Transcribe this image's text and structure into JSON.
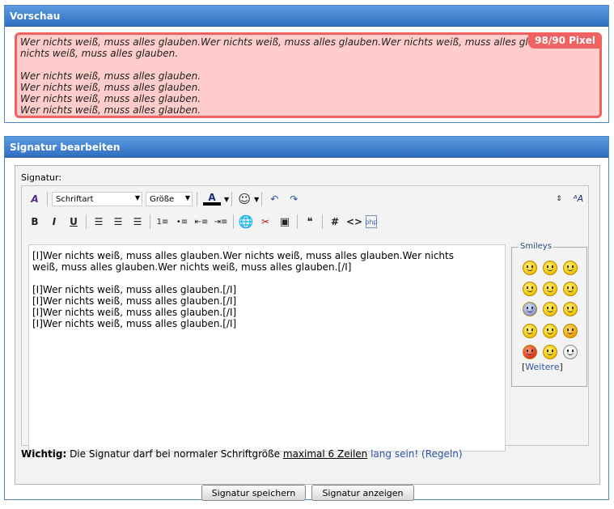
{
  "preview": {
    "title": "Vorschau",
    "badge": "98/90 Pixel",
    "lines": [
      "Wer nichts weiß, muss alles glauben.Wer nichts weiß, muss alles glauben.Wer nichts weiß, muss alles glauben.Wer",
      "nichts weiß, muss alles glauben.",
      "",
      "Wer nichts weiß, muss alles glauben.",
      "Wer nichts weiß, muss alles glauben.",
      "Wer nichts weiß, muss alles glauben.",
      "Wer nichts weiß, muss alles glauben."
    ]
  },
  "editor": {
    "title": "Signatur bearbeiten",
    "label": "Signatur:",
    "font_select": "Schriftart",
    "size_select": "Größe",
    "text_lines": [
      "[I]Wer nichts weiß, muss alles glauben.Wer nichts weiß, muss alles glauben.Wer nichts",
      "weiß, muss alles glauben.Wer nichts weiß, muss alles glauben.[/I]",
      "",
      "[I]Wer nichts weiß, muss alles glauben.[/I]",
      "[I]Wer nichts weiß, muss alles glauben.[/I]",
      "[I]Wer nichts weiß, muss alles glauben.[/I]",
      "[I]Wer nichts weiß, muss alles glauben.[/I]"
    ],
    "smileys_legend": "Smileys",
    "weitere": "Weitere",
    "notice_strong": "Wichtig:",
    "notice_text": " Die Signatur darf bei normaler Schriftgröße ",
    "notice_underline": "maximal 6 Zeilen",
    "notice_after": " lang sein! (",
    "notice_link": "Regeln",
    "notice_close": ")",
    "save_button": "Signatur speichern",
    "show_button": "Signatur anzeigen"
  }
}
